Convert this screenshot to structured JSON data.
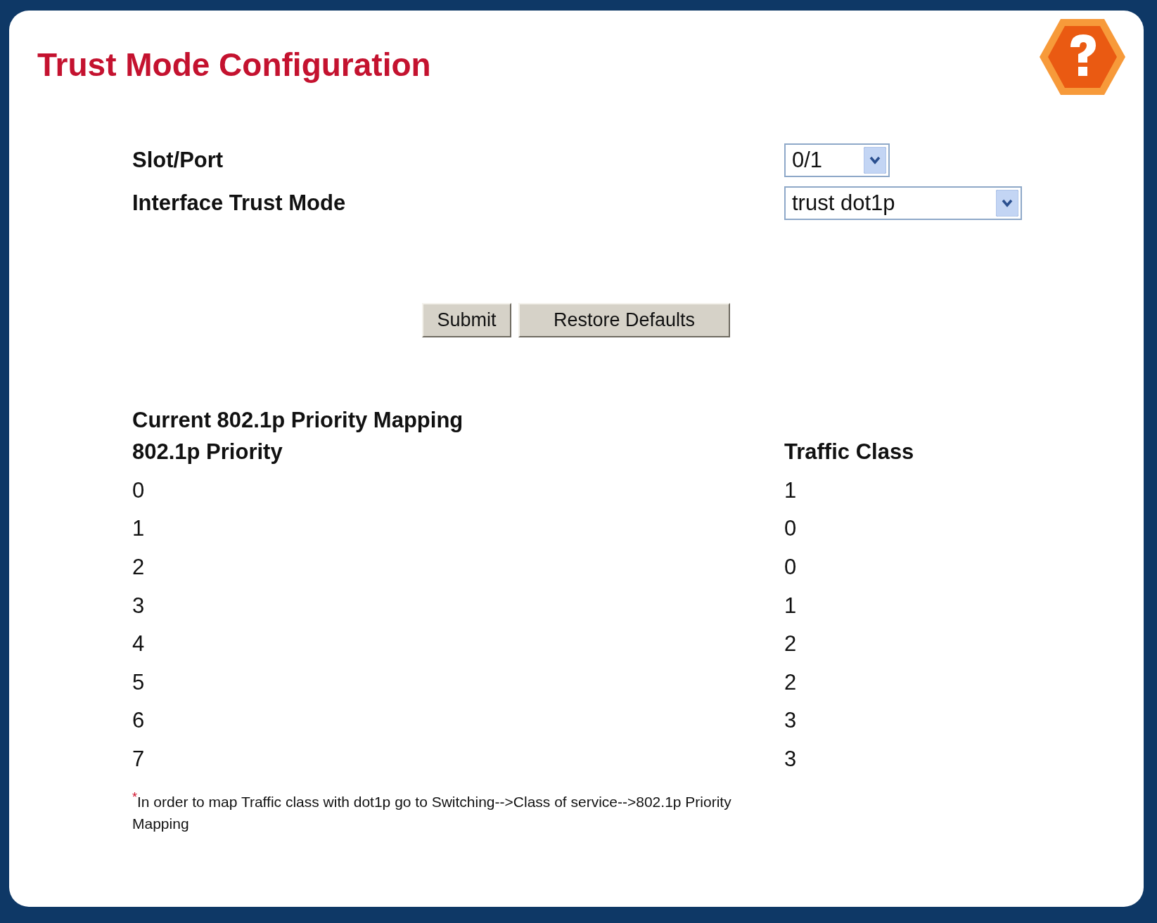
{
  "title": "Trust Mode Configuration",
  "form": [
    {
      "label": "Slot/Port",
      "value": "0/1",
      "kind": "narrow"
    },
    {
      "label": "Interface Trust Mode",
      "value": "trust dot1p",
      "kind": "wide"
    }
  ],
  "buttons": [
    "Submit",
    "Restore Defaults"
  ],
  "mapping": {
    "title": "Current 802.1p Priority Mapping",
    "columns": [
      "802.1p Priority",
      "Traffic Class"
    ],
    "rows": [
      [
        "0",
        "1"
      ],
      [
        "1",
        "0"
      ],
      [
        "2",
        "0"
      ],
      [
        "3",
        "1"
      ],
      [
        "4",
        "2"
      ],
      [
        "5",
        "2"
      ],
      [
        "6",
        "3"
      ],
      [
        "7",
        "3"
      ]
    ]
  },
  "footnote": {
    "mark": "*",
    "text": "In order to map Traffic class with dot1p go to Switching-->Class of service-->802.1p Priority Mapping"
  }
}
